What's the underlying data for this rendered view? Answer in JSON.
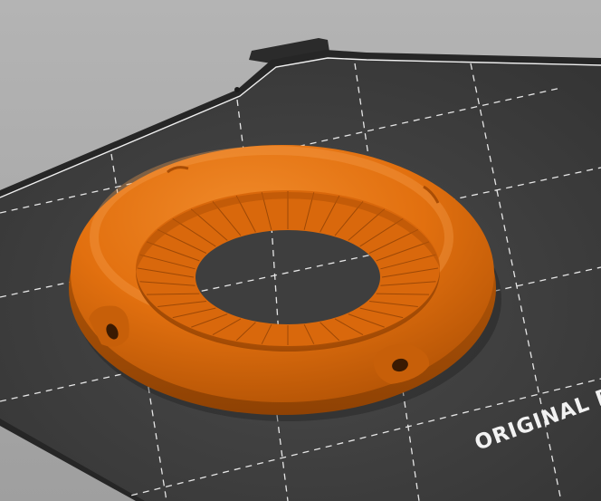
{
  "viewport": {
    "background_color": "#a9a9a9"
  },
  "print_bed": {
    "surface_color": "#393939",
    "edge_color": "#242424",
    "grid_color": "#e8e8e8",
    "label": "ORIGINAL P"
  },
  "model": {
    "shape": "torus-ring",
    "color": "#e6730f",
    "inner_disc": "ribbed-flange",
    "mount_holes": 2
  }
}
